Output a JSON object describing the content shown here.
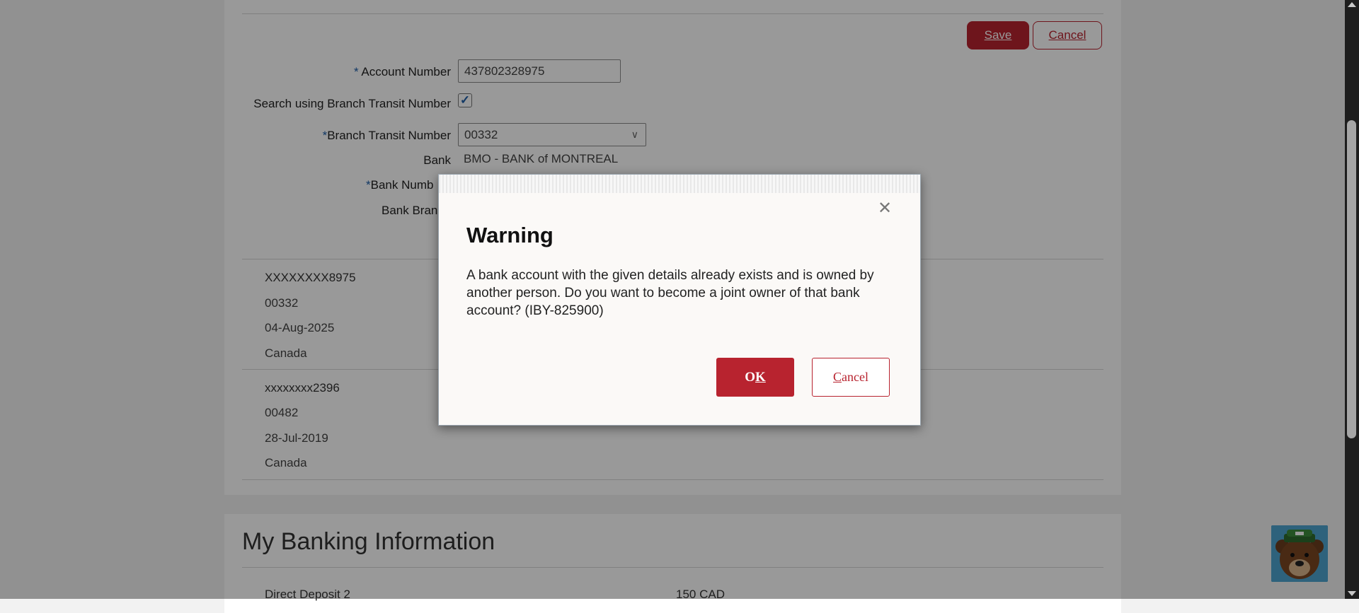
{
  "form": {
    "save_label": "Save",
    "cancel_label": "Cancel",
    "account_number_label": "Account Number",
    "account_number_value": "437802328975",
    "search_transit_label": "Search using Branch Transit Number",
    "search_transit_checked": true,
    "branch_transit_label": "Branch Transit Number",
    "branch_transit_value": "00332",
    "bank_label": "Bank",
    "bank_value": "BMO - BANK of MONTREAL",
    "bank_number_label": "Bank Numb",
    "bank_branch_label": "Bank Bran",
    "required_mark": "*"
  },
  "accounts": [
    {
      "number": "XXXXXXXX8975",
      "transit": "00332",
      "date": "04-Aug-2025",
      "country": "Canada"
    },
    {
      "number": "xxxxxxxx2396",
      "transit": "00482",
      "date": "28-Jul-2019",
      "country": "Canada"
    }
  ],
  "banking_info": {
    "title": "My Banking Information",
    "rows": [
      {
        "label": "Direct Deposit 2",
        "amount": "150 CAD"
      }
    ]
  },
  "dialog": {
    "title": "Warning",
    "message": "A bank account with the given details already exists and is owned by another person. Do you want to become a joint owner of that bank account? (IBY-825900)",
    "ok_label": "OK",
    "cancel_label": "Cancel",
    "close_icon": "close-icon"
  },
  "colors": {
    "brand_red": "#b8232f",
    "required_blue": "#1d5ea8",
    "overlay": "rgba(0,0,0,0.40)"
  }
}
